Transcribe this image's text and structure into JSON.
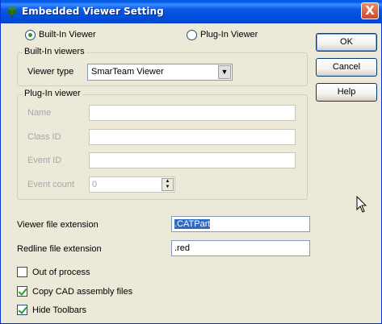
{
  "window": {
    "title": "Embedded Viewer Setting",
    "close_label": "X"
  },
  "viewer_mode": {
    "builtin_label": "Built-In Viewer",
    "plugin_label": "Plug-In Viewer",
    "selected": "builtin"
  },
  "builtin_group": {
    "title": "Built-In viewers",
    "viewer_type_label": "Viewer type",
    "viewer_type_value": "SmarTeam Viewer"
  },
  "plugin_group": {
    "title": "Plug-In viewer",
    "name_label": "Name",
    "name_value": "",
    "class_id_label": "Class ID",
    "class_id_value": "",
    "event_id_label": "Event ID",
    "event_id_value": "",
    "event_count_label": "Event count",
    "event_count_value": "0"
  },
  "extensions": {
    "viewer_label": "Viewer file extension",
    "viewer_value": ".CATPart",
    "redline_label": "Redline file extension",
    "redline_value": ".red"
  },
  "options": [
    {
      "label": "Out of process",
      "checked": false
    },
    {
      "label": "Copy CAD assembly files",
      "checked": true
    },
    {
      "label": "Hide Toolbars",
      "checked": true
    }
  ],
  "buttons": {
    "ok": "OK",
    "cancel": "Cancel",
    "help": "Help"
  },
  "icons": {
    "title": "tree-app-icon",
    "cursor": "mouse-pointer-icon"
  }
}
